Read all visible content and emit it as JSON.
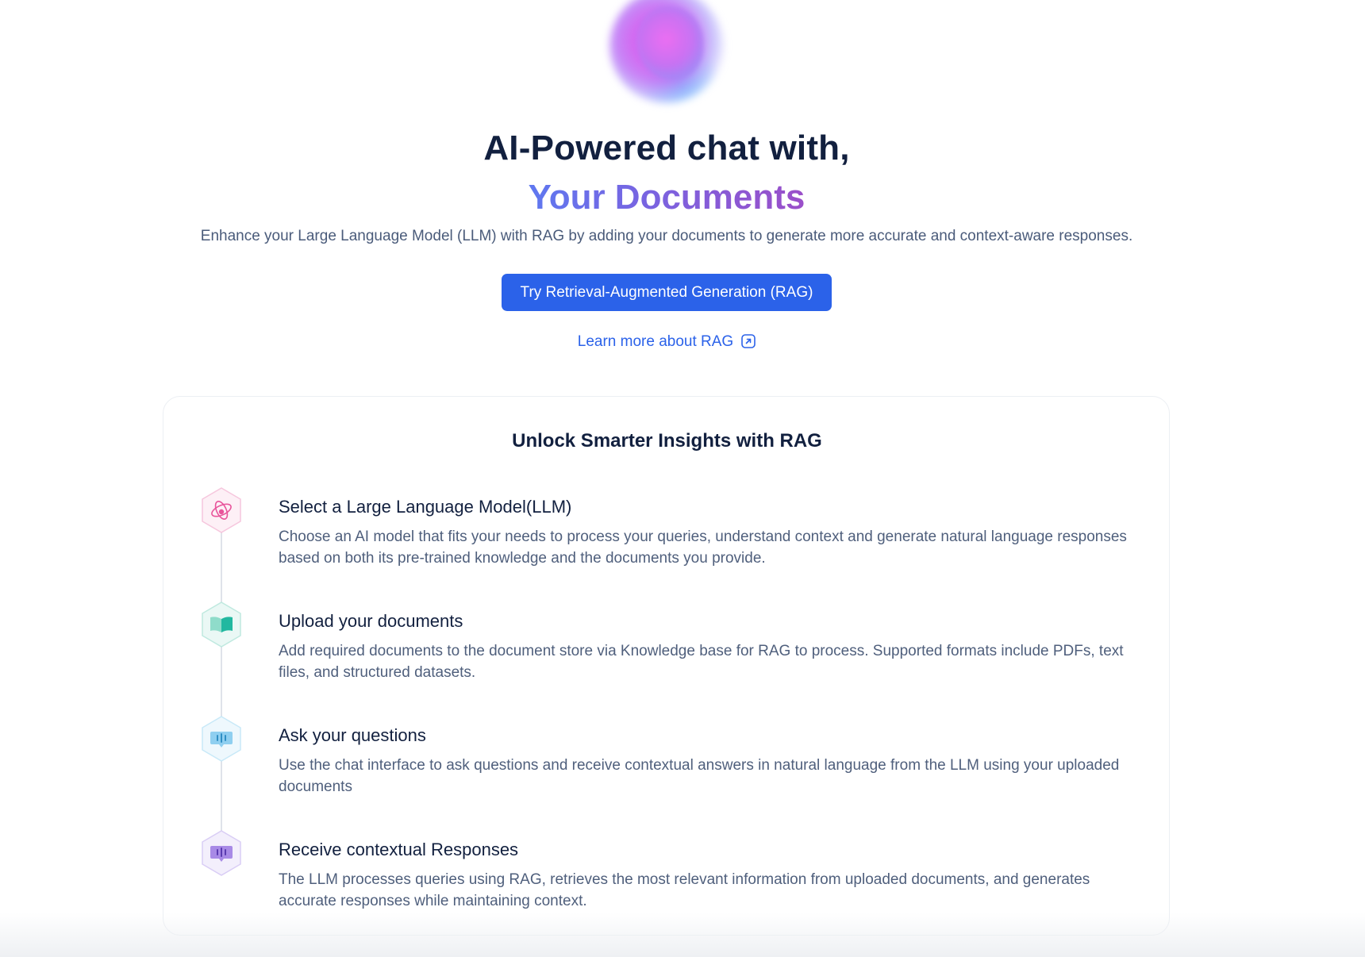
{
  "hero": {
    "title_line1": "AI-Powered chat with,",
    "title_line2": "Your Documents",
    "subtitle": "Enhance your Large Language Model (LLM) with RAG by adding your documents to generate more accurate and context-aware responses.",
    "cta_label": "Try Retrieval-Augmented Generation (RAG)",
    "learn_more_label": "Learn more about RAG",
    "learn_more_icon": "external-link-icon"
  },
  "insights": {
    "title": "Unlock Smarter Insights with RAG",
    "steps": [
      {
        "title": "Select a Large Language Model(LLM)",
        "description": "Choose an AI model that fits your needs to process your queries, understand context and generate natural language responses based on both its pre-trained knowledge and the documents you provide.",
        "icon": "atom-icon",
        "color": "#e8559b"
      },
      {
        "title": "Upload your documents",
        "description": "Add required documents to the document store via Knowledge base for RAG to process. Supported formats include PDFs, text files, and structured datasets.",
        "icon": "book-icon",
        "color": "#22b8a0"
      },
      {
        "title": "Ask your questions",
        "description": "Use the chat interface to ask questions and receive contextual answers in natural language from the LLM using your uploaded documents",
        "icon": "chat-bubble-icon",
        "color": "#4aaee0"
      },
      {
        "title": "Receive contextual Responses",
        "description": "The LLM processes queries using RAG, retrieves the most relevant information from uploaded documents, and generates accurate responses while maintaining context.",
        "icon": "response-bubble-icon",
        "color": "#8a63d8"
      }
    ]
  },
  "colors": {
    "primary": "#2b62e9",
    "heading": "#12203f",
    "body_text": "#4f5f7c"
  }
}
